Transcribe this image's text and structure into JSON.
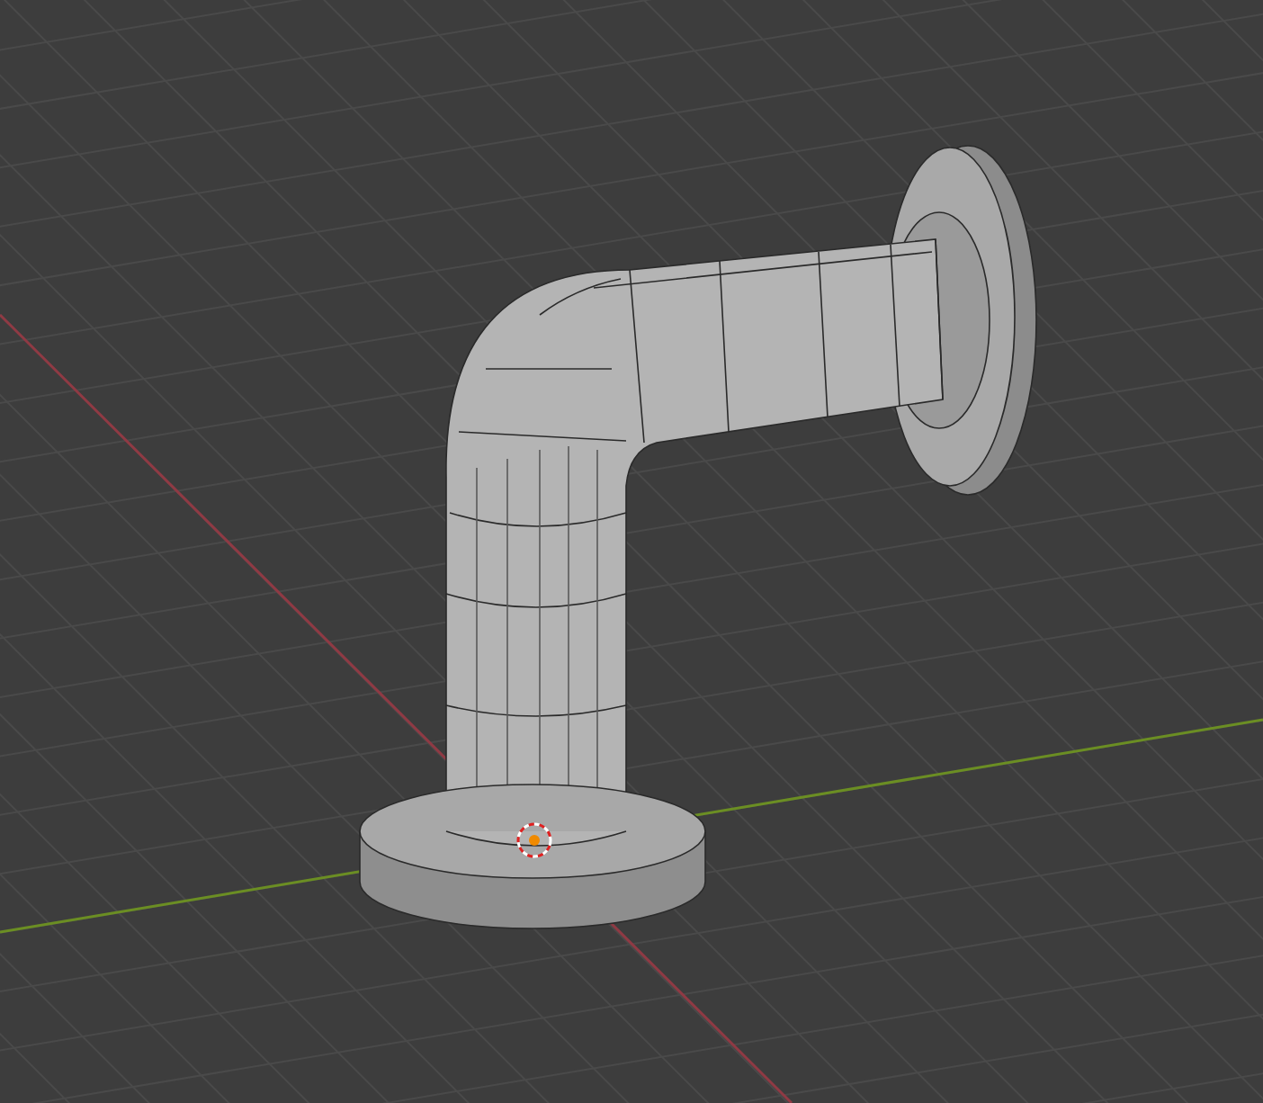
{
  "viewport": {
    "grid": true,
    "x_axis": true,
    "y_axis": true,
    "origin_marker": true
  }
}
